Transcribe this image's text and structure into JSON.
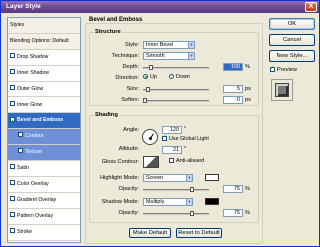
{
  "window": {
    "title": "Layer Style",
    "close_glyph": "X"
  },
  "left_list": [
    {
      "label": "Styles",
      "kind": "hdr",
      "checkbox": false,
      "checked": false
    },
    {
      "label": "Blending Options: Default",
      "kind": "hdr",
      "checkbox": false,
      "checked": false
    },
    {
      "label": "Drop Shadow",
      "kind": "item",
      "checkbox": true,
      "checked": false
    },
    {
      "label": "Inner Shadow",
      "kind": "item",
      "checkbox": true,
      "checked": false
    },
    {
      "label": "Outer Glow",
      "kind": "item",
      "checkbox": true,
      "checked": false
    },
    {
      "label": "Inner Glow",
      "kind": "item",
      "checkbox": true,
      "checked": false
    },
    {
      "label": "Bevel and Emboss",
      "kind": "sel",
      "checkbox": true,
      "checked": true
    },
    {
      "label": "Contour",
      "kind": "sub",
      "checkbox": true,
      "checked": false
    },
    {
      "label": "Texture",
      "kind": "sub",
      "checkbox": true,
      "checked": false
    },
    {
      "label": "Satin",
      "kind": "item",
      "checkbox": true,
      "checked": false
    },
    {
      "label": "Color Overlay",
      "kind": "item",
      "checkbox": true,
      "checked": false
    },
    {
      "label": "Gradient Overlay",
      "kind": "item",
      "checkbox": true,
      "checked": false
    },
    {
      "label": "Pattern Overlay",
      "kind": "item",
      "checkbox": true,
      "checked": false
    },
    {
      "label": "Stroke",
      "kind": "item",
      "checkbox": true,
      "checked": false
    }
  ],
  "buttons": {
    "ok": "OK",
    "cancel": "Cancel",
    "new_style": "New Style...",
    "preview": "Preview"
  },
  "panel": {
    "title": "Bevel and Emboss",
    "structure": {
      "legend": "Structure",
      "style_label": "Style:",
      "style_value": "Inner Bevel",
      "technique_label": "Technique:",
      "technique_value": "Smooth",
      "depth_label": "Depth:",
      "depth_value": "100",
      "depth_unit": "%",
      "depth_level": 0.1,
      "direction_label": "Direction:",
      "dir_up": "Up",
      "dir_down": "Down",
      "size_label": "Size:",
      "size_value": "5",
      "size_unit": "px",
      "size_level": 0.05,
      "soften_label": "Soften:",
      "soften_value": "0",
      "soften_unit": "px",
      "soften_level": 0
    },
    "shading": {
      "legend": "Shading",
      "angle_label": "Angle:",
      "angle_value": "120",
      "angle_unit": "°",
      "global_light": "Use Global Light",
      "altitude_label": "Altitude:",
      "altitude_value": "21",
      "altitude_unit": "°",
      "gloss_label": "Gloss Contour:",
      "anti_aliased": "Anti-aliased",
      "highlight_label": "Highlight Mode:",
      "highlight_value": "Screen",
      "highlight_color": "#ffffff",
      "h_opacity_label": "Opacity:",
      "h_opacity_value": "75",
      "h_opacity_unit": "%",
      "h_opacity_level": 0.75,
      "shadow_label": "Shadow Mode:",
      "shadow_value": "Multiply",
      "shadow_color": "#000000",
      "s_opacity_label": "Opacity:",
      "s_opacity_value": "75",
      "s_opacity_unit": "%",
      "s_opacity_level": 0.75
    },
    "make_default": "Make Default",
    "reset_default": "Reset to Default"
  }
}
